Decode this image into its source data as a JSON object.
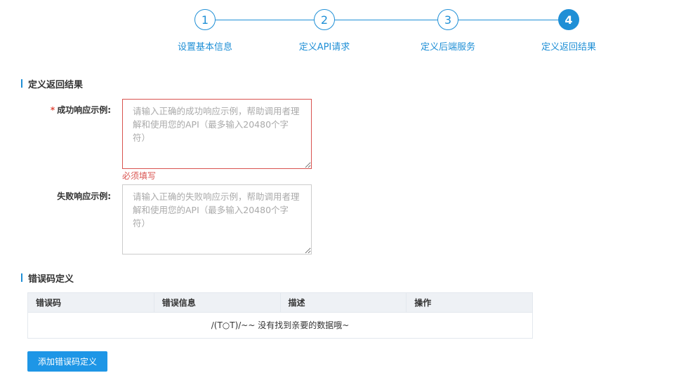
{
  "steps": [
    {
      "number": "1",
      "label": "设置基本信息",
      "active": false
    },
    {
      "number": "2",
      "label": "定义API请求",
      "active": false
    },
    {
      "number": "3",
      "label": "定义后端服务",
      "active": false
    },
    {
      "number": "4",
      "label": "定义返回结果",
      "active": true
    }
  ],
  "return_section": {
    "title": "定义返回结果",
    "success": {
      "required_mark": "*",
      "label": "成功响应示例:",
      "placeholder": "请输入正确的成功响应示例，帮助调用者理解和使用您的API（最多输入20480个字符）",
      "value": "",
      "error": "必须填写"
    },
    "failure": {
      "label": "失败响应示例:",
      "placeholder": "请输入正确的失败响应示例，帮助调用者理解和使用您的API（最多输入20480个字符）",
      "value": ""
    }
  },
  "error_section": {
    "title": "错误码定义",
    "columns": [
      "错误码",
      "错误信息",
      "描述",
      "操作"
    ],
    "empty_text": "/(T○T)/~~ 没有找到亲要的数据哦~",
    "add_button": "添加错误码定义"
  },
  "colors": {
    "accent": "#1f8fd6",
    "error": "#d9534f",
    "button": "#1e96e6"
  }
}
